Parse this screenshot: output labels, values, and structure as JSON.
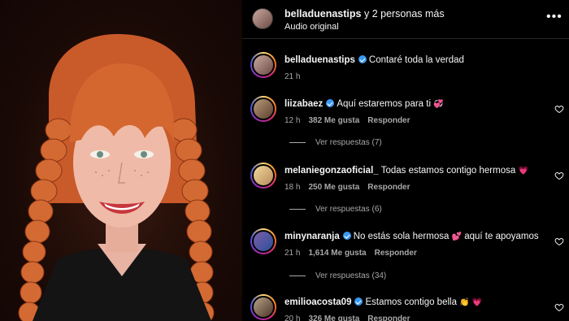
{
  "header": {
    "username": "belladuenastips",
    "suffix": "y 2 personas más",
    "audio": "Audio original",
    "more_icon": "more-options-icon"
  },
  "caption": {
    "username": "belladuenastips",
    "text": "Contaré toda la verdad",
    "time": "21 h"
  },
  "comments": [
    {
      "username": "liizabaez",
      "verified": true,
      "text": "Aquí estaremos para ti",
      "emoji": "💞",
      "time": "12 h",
      "likes": "382 Me gusta",
      "reply": "Responder",
      "replies": "Ver respuestas (7)"
    },
    {
      "username": "melaniegonzaoficial_",
      "verified": false,
      "text": "Todas estamos contigo hermosa",
      "emoji": "💗",
      "time": "18 h",
      "likes": "250 Me gusta",
      "reply": "Responder",
      "replies": "Ver respuestas (6)"
    },
    {
      "username": "minynaranja",
      "verified": true,
      "text": "No estás sola hermosa",
      "emoji": "💕",
      "text2": "aquí te apoyamos",
      "time": "21 h",
      "likes": "1,614 Me gusta",
      "reply": "Responder",
      "replies": "Ver respuestas (34)"
    },
    {
      "username": "emilioacosta09",
      "verified": true,
      "text": "Estamos contigo bella",
      "emoji": "👏",
      "emoji2": "💗",
      "time": "20 h",
      "likes": "326 Me gusta",
      "reply": "Responder",
      "replies": ""
    }
  ],
  "colors": {
    "background": "#000000",
    "verified": "#3897f0",
    "muted": "#a8a8a8",
    "hair": "#d2642f"
  }
}
